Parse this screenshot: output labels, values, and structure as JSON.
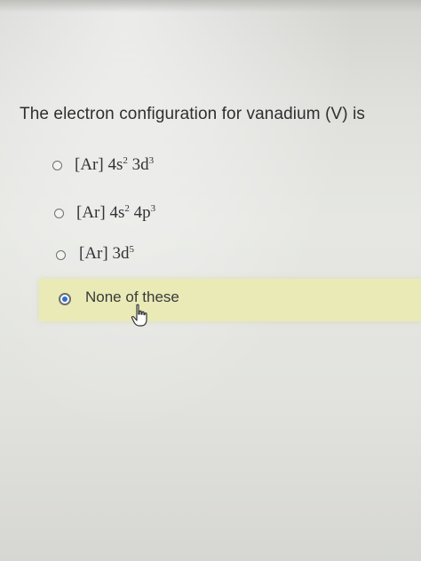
{
  "question": {
    "text": "The electron configuration for vanadium (V) is"
  },
  "options": [
    {
      "base": "[Ar] 4s",
      "sup1": "2",
      "mid": " 3d",
      "sup2": "3",
      "selected": false
    },
    {
      "base": "[Ar] 4s",
      "sup1": "2",
      "mid": " 4p",
      "sup2": "3",
      "selected": false
    },
    {
      "base": "[Ar] 3d",
      "sup1": "5",
      "mid": "",
      "sup2": "",
      "selected": false
    },
    {
      "label": "None of these",
      "selected": true
    }
  ],
  "colors": {
    "selected_highlight": "#e9eab6",
    "radio_fill": "#2d6fd0"
  },
  "icons": {
    "cursor": "hand-pointer-icon"
  }
}
